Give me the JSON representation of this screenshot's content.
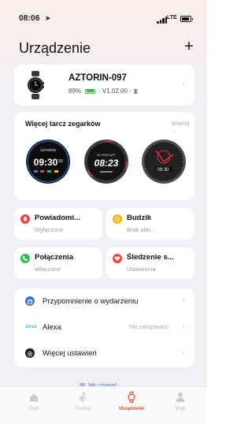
{
  "status_bar": {
    "time": "08:06",
    "network": "LTE"
  },
  "header": {
    "title": "Urządzenie",
    "add_label": "+"
  },
  "device": {
    "name": "AZTORIN-097",
    "battery": "89%",
    "battery_level": 0.89,
    "version": "· V1.02.00 ·",
    "bluetooth_icon": "bluetooth-icon"
  },
  "watch_faces": {
    "title": "Więcej tarcz zegarków",
    "more_label": "Więcej",
    "faces": [
      {
        "brand": "AZTORIN",
        "time": "09:30",
        "seconds": "56",
        "colors": [
          "#101010",
          "#2e7dd7"
        ]
      },
      {
        "time": "08:23",
        "date": "26 FEBRUARY",
        "colors": [
          "#2a2a2a",
          "#ffffff"
        ]
      },
      {
        "time": "09:30",
        "colors": [
          "#2b2b2b",
          "#e0353a"
        ]
      }
    ]
  },
  "tiles": [
    {
      "title": "Powiadomi...",
      "subtitle": "Wyłączone",
      "icon": "bell-icon",
      "color": "#f04444"
    },
    {
      "title": "Budzik",
      "subtitle": "Brak alar...",
      "icon": "alarm-clock-icon",
      "color": "#f6b400"
    },
    {
      "title": "Połączenia",
      "subtitle": "Włączone",
      "icon": "phone-icon",
      "color": "#2fbe5b"
    },
    {
      "title": "Śledzenie s...",
      "subtitle": "Ustawienia",
      "icon": "heart-icon",
      "color": "#f04444"
    }
  ],
  "list": [
    {
      "label": "Przypomnienie o wydarzeniu",
      "value": "",
      "icon": "calendar-icon",
      "color": "#3f6fe0"
    },
    {
      "label": "Alexa",
      "value": "Nie zalogowano",
      "icon": "alexa-icon",
      "color": "#1ea0e8"
    },
    {
      "label": "Więcej ustawień",
      "value": "",
      "icon": "gear-icon",
      "color": "#1a1a1a"
    }
  ],
  "help_link": "Jak używać",
  "tabs": [
    {
      "label": "Dom",
      "icon": "home-icon",
      "active": false
    },
    {
      "label": "Trening",
      "icon": "running-icon",
      "active": false
    },
    {
      "label": "Urządzenie",
      "icon": "watch-icon",
      "active": true
    },
    {
      "label": "Moje",
      "icon": "person-icon",
      "active": false
    }
  ],
  "accent_color": "#e8432d"
}
